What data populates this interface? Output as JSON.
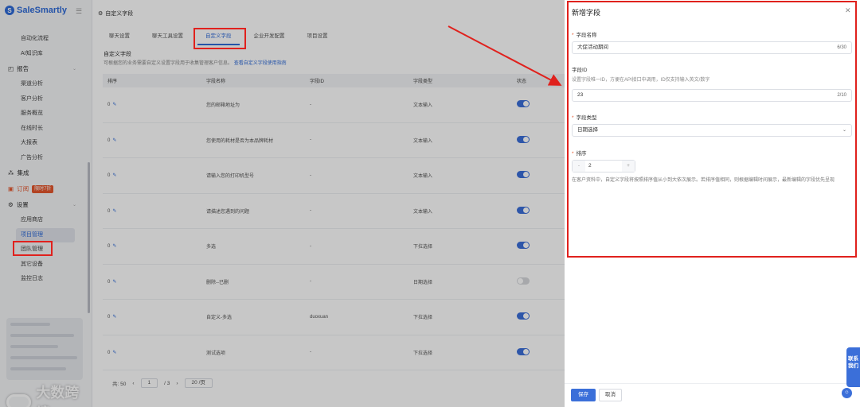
{
  "brand": {
    "name": "SaleSmartly"
  },
  "sidebar": {
    "items": [
      {
        "label": "自动化流程",
        "kind": "sub"
      },
      {
        "label": "AI知识库",
        "kind": "sub"
      },
      {
        "label": "报告",
        "kind": "group",
        "icon": "chart-icon"
      },
      {
        "label": "渠道分析",
        "kind": "sub"
      },
      {
        "label": "客户分析",
        "kind": "sub"
      },
      {
        "label": "服务概览",
        "kind": "sub"
      },
      {
        "label": "在线时长",
        "kind": "sub"
      },
      {
        "label": "大报表",
        "kind": "sub"
      },
      {
        "label": "广告分析",
        "kind": "sub"
      },
      {
        "label": "集成",
        "kind": "group",
        "icon": "integration-icon"
      },
      {
        "label": "订阅",
        "kind": "group",
        "icon": "subscribe-icon",
        "badge": "限时7折"
      },
      {
        "label": "设置",
        "kind": "group",
        "icon": "gear-icon"
      },
      {
        "label": "应用商店",
        "kind": "sub"
      },
      {
        "label": "项目管理",
        "kind": "sub",
        "active": true
      },
      {
        "label": "团队管理",
        "kind": "sub"
      },
      {
        "label": "其它设备",
        "kind": "sub"
      },
      {
        "label": "监控日志",
        "kind": "sub"
      }
    ]
  },
  "watermark": {
    "text": "大数跨境"
  },
  "page": {
    "title": "自定义字段",
    "tabs": [
      "聊天设置",
      "聊天工具设置",
      "自定义字段",
      "企业开发配置",
      "项目设置"
    ],
    "active_tab": 2,
    "section_title": "自定义字段",
    "section_desc": "可根据您的业务需要自定义设置字段用于收集管理客户信息。",
    "section_link": "查看自定义字段使用指南"
  },
  "table": {
    "headers": [
      "排序",
      "字段名称",
      "字段ID",
      "字段类型",
      "状态"
    ],
    "rows": [
      {
        "sort": "0",
        "name": "您的邮箱地址为",
        "id": "-",
        "type": "文本输入",
        "on": true
      },
      {
        "sort": "0",
        "name": "您使用的耗材是否为本品牌耗材",
        "id": "-",
        "type": "文本输入",
        "on": true
      },
      {
        "sort": "0",
        "name": "请输入您的打印机型号",
        "id": "-",
        "type": "文本输入",
        "on": true
      },
      {
        "sort": "0",
        "name": "请描述您遇到的问题",
        "id": "-",
        "type": "文本输入",
        "on": true
      },
      {
        "sort": "0",
        "name": "多选",
        "id": "-",
        "type": "下拉选择",
        "on": true
      },
      {
        "sort": "0",
        "name": "删除--已删",
        "id": "-",
        "type": "日期选择",
        "on": false
      },
      {
        "sort": "0",
        "name": "自定义-多选",
        "id": "duoxuan",
        "type": "下拉选择",
        "on": true
      },
      {
        "sort": "0",
        "name": "测试选项",
        "id": "-",
        "type": "下拉选择",
        "on": true
      }
    ]
  },
  "pagination": {
    "total_label": "共: 50",
    "page": "1",
    "pages": "/ 3",
    "size": "20 /页"
  },
  "drawer": {
    "title": "新增字段",
    "name_label": "字段名称",
    "name_value": "大促活动期间",
    "name_count": "6/30",
    "id_label": "字段ID",
    "id_hint": "设置字段唯一ID，方便在API接口中调用，ID仅支持输入英文/数字",
    "id_value": "23",
    "id_count": "2/10",
    "type_label": "字段类型",
    "type_value": "日期选择",
    "sort_label": "排序",
    "sort_minus": "-",
    "sort_value": "2",
    "sort_plus": "+",
    "sort_desc": "在客户资料中，自定义字段将按照排序值从小到大依次展示。若排序值相同，则根据编辑时间展示，最新编辑的字段优先呈现",
    "save_label": "保存",
    "cancel_label": "取消"
  },
  "contact": {
    "label": "联系我们"
  },
  "colors": {
    "accent": "#3b6fd9",
    "annotation": "#e0211d",
    "brand": "#2f6bd8"
  }
}
